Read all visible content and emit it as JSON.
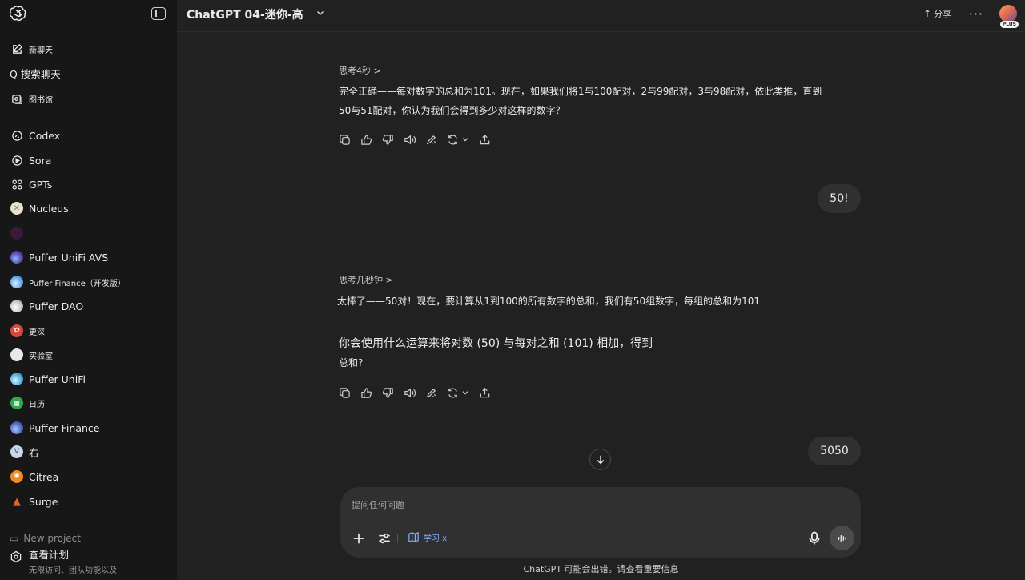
{
  "header": {
    "model": "ChatGPT 04-迷你-高",
    "share_label": "分享",
    "more_label": "···",
    "plan_badge": "PLUS"
  },
  "sidebar": {
    "new_chat": "新聊天",
    "search": "Q 搜索聊天",
    "library": "图书馆",
    "items": [
      {
        "label": "Codex"
      },
      {
        "label": "Sora"
      },
      {
        "label": "GPTs"
      },
      {
        "label": "Nucleus"
      },
      {
        "label": ""
      },
      {
        "label": "Puffer UniFi AVS"
      },
      {
        "label": "Puffer Finance（开发版）"
      },
      {
        "label": "Puffer DAO"
      },
      {
        "label": "更深"
      },
      {
        "label": "实验室"
      },
      {
        "label": "Puffer UniFi"
      },
      {
        "label": "日历"
      },
      {
        "label": "Puffer Finance"
      },
      {
        "label": "右"
      },
      {
        "label": "Citrea"
      },
      {
        "label": "Surge"
      }
    ],
    "new_project": "New project",
    "plan_title": "查看计划",
    "plan_sub": "无限访问、团队功能以及"
  },
  "chat": {
    "think1": "思考4秒 >",
    "msg1_line1": "完全正确——每对数字的总和为101。现在，如果我们将1与100配对，2与99配对，3与98配对，依此类推，直到",
    "msg1_line2": "50与51配对，你认为我们会得到多少对这样的数字？",
    "user1": "50!",
    "think2": "思考几秒钟 >",
    "msg2_line1": "太棒了——50对！现在，要计算从1到100的所有数字的总和，我们有50组数字，每组的总和为101",
    "msg2_line2": "你会使用什么运算来将对数 (50) 与每对之和 (101) 相加，得到",
    "msg2_line3": "总和?",
    "user2": "5050"
  },
  "composer": {
    "placeholder": "提问任何问题",
    "study_label": "学习 x"
  },
  "disclaimer": "ChatGPT 可能会出错。请查看重要信息",
  "colors": {
    "background": "#212121",
    "sidebar": "#171717",
    "bubble": "#303030",
    "accent": "#7fb0ff"
  }
}
